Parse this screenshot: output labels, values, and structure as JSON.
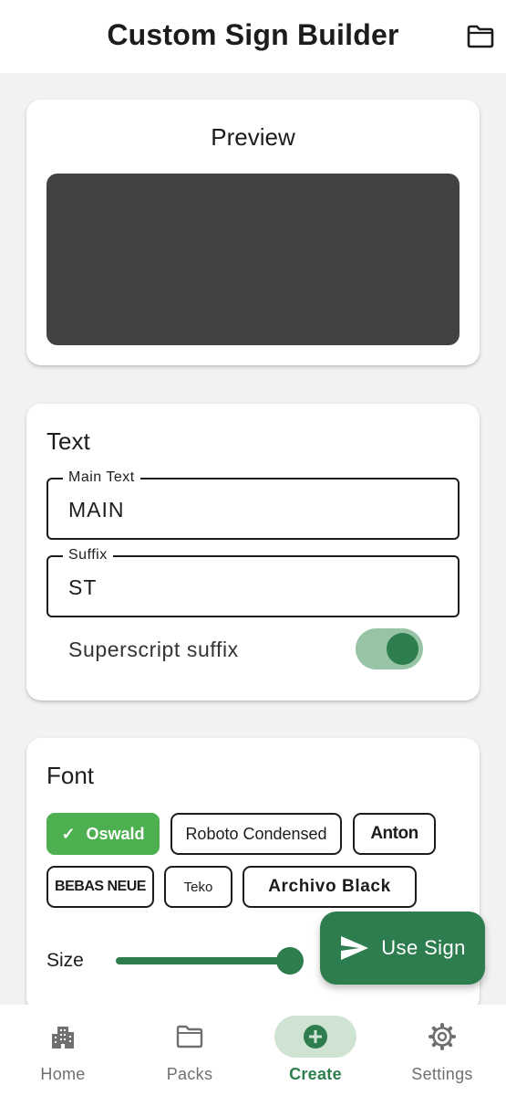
{
  "app_bar": {
    "title": "Custom Sign Builder",
    "folder_icon": "folder-icon"
  },
  "preview": {
    "title": "Preview",
    "background": "#424242"
  },
  "text_section": {
    "title": "Text",
    "main_text": {
      "label": "Main Text",
      "value": "MAIN"
    },
    "suffix": {
      "label": "Suffix",
      "value": "ST"
    },
    "superscript": {
      "label": "Superscript suffix",
      "enabled": true
    }
  },
  "font_section": {
    "title": "Font",
    "fonts": [
      "Oswald",
      "Roboto Condensed",
      "Anton",
      "BEBAS NEUE",
      "Teko",
      "Archivo Black"
    ],
    "selected": "Oswald",
    "size_label": "Size"
  },
  "fab": {
    "label": "Use Sign",
    "icon": "send-icon"
  },
  "bottom_nav": {
    "items": [
      {
        "label": "Home",
        "icon": "city-icon",
        "active": false
      },
      {
        "label": "Packs",
        "icon": "folder-icon",
        "active": false
      },
      {
        "label": "Create",
        "icon": "add-circle-icon",
        "active": true
      },
      {
        "label": "Settings",
        "icon": "gear-icon",
        "active": false
      }
    ]
  },
  "colors": {
    "accent": "#2e7d4f",
    "chip_selected": "#4caf50",
    "toggle_track": "#98c4a6",
    "nav_active_bg": "#cfe3d3"
  }
}
